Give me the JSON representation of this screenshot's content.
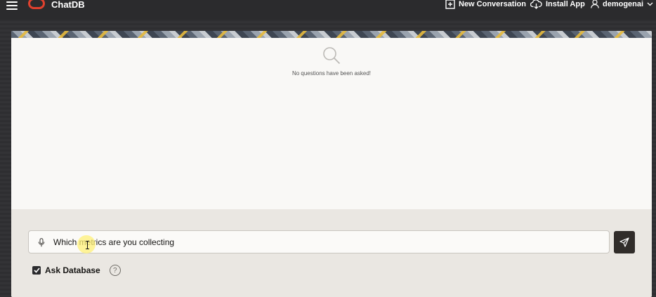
{
  "header": {
    "app_title": "ChatDB",
    "new_conversation_label": "New Conversation",
    "install_app_label": "Install App",
    "user_name": "demogenai"
  },
  "main": {
    "empty_state_text": "No questions have been asked!"
  },
  "prompt": {
    "value": "Which metrics are you collecting",
    "placeholder": ""
  },
  "options": {
    "ask_database_label": "Ask Database",
    "ask_database_checked": true,
    "help_glyph": "?"
  },
  "icons": {
    "menu": "hamburger-icon",
    "logo": "oracle-logo",
    "new_conversation": "plus-square-icon",
    "install_app": "cloud-download-icon",
    "user": "user-icon",
    "user_menu": "chevron-down-icon",
    "empty_state": "search-icon",
    "mic": "microphone-icon",
    "send": "send-icon"
  },
  "colors": {
    "topbar_bg": "#2b2b2d",
    "logo_red": "#e0412e",
    "content_bg": "#f9f8f6",
    "footer_bg": "#eae7e2",
    "send_button_bg": "#312d2a"
  }
}
